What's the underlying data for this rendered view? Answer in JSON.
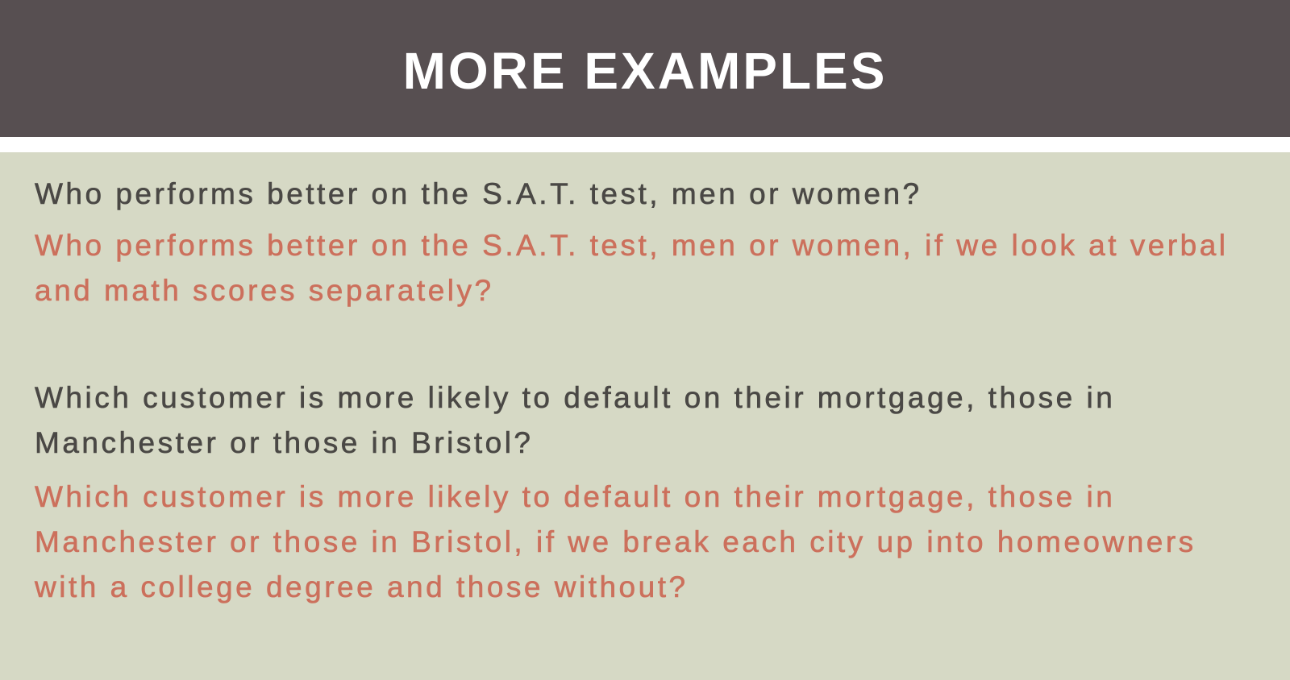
{
  "slide": {
    "title": "MORE EXAMPLES",
    "colors": {
      "header_bg": "#574f51",
      "content_bg": "#d6d9c5",
      "text_dark": "#4a4845",
      "text_accent": "#cc705c"
    },
    "paragraphs": [
      {
        "text": "Who performs better on the S.A.T. test, men or women?",
        "style": "dark"
      },
      {
        "text": "Who performs better on the S.A.T. test, men or women, if we look at verbal and math scores separately?",
        "style": "accent"
      },
      {
        "text": "Which customer is more likely to default on their mortgage, those in Manchester or those in Bristol?",
        "style": "dark"
      },
      {
        "text": "Which customer is more likely to default on their mortgage, those in Manchester or those in Bristol, if we break each city up into homeowners with a college degree and those without?",
        "style": "accent"
      }
    ]
  }
}
